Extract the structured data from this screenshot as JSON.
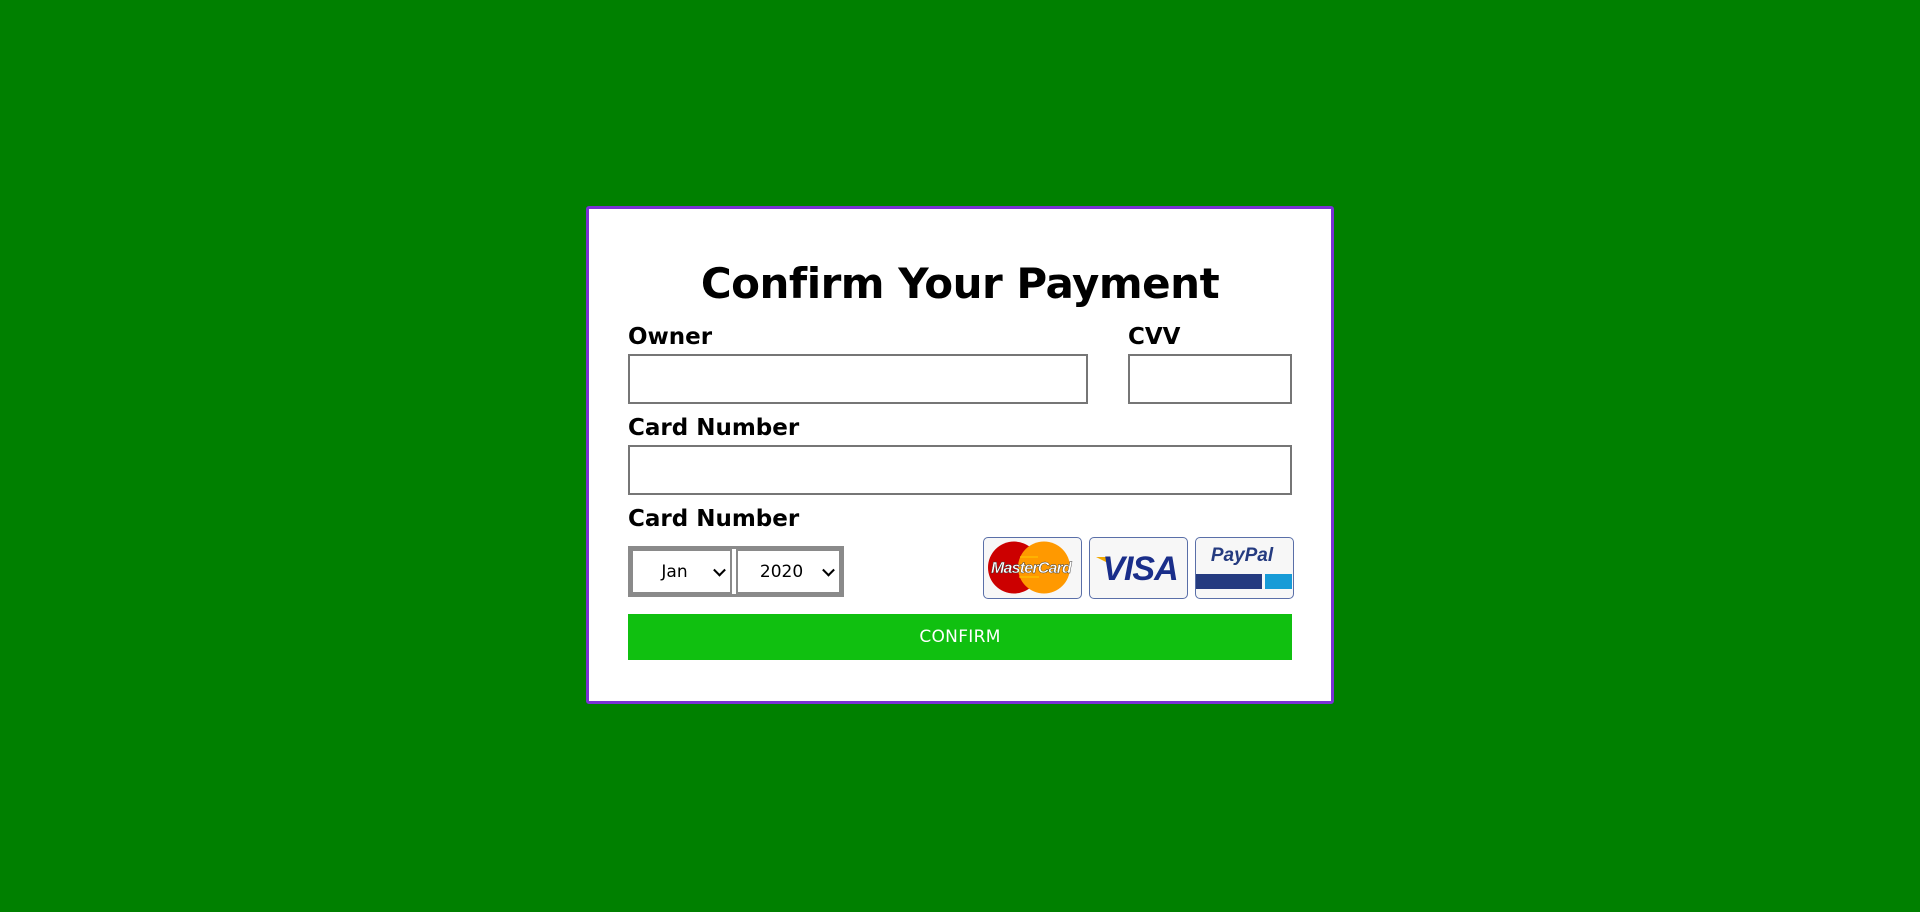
{
  "form": {
    "title": "Confirm Your Payment",
    "owner_label": "Owner",
    "owner_value": "",
    "cvv_label": "CVV",
    "cvv_value": "",
    "card_number_label": "Card Number",
    "card_number_value": "",
    "expiry_label": "Card Number",
    "month_selected": "Jan",
    "year_selected": "2020",
    "confirm_label": "CONFIRM"
  },
  "payment_logos": {
    "mastercard": "MasterCard",
    "visa": "VISA",
    "paypal": "PayPal"
  },
  "colors": {
    "background": "#008000",
    "card_border": "#7a30d6",
    "confirm_button": "#10c010"
  }
}
